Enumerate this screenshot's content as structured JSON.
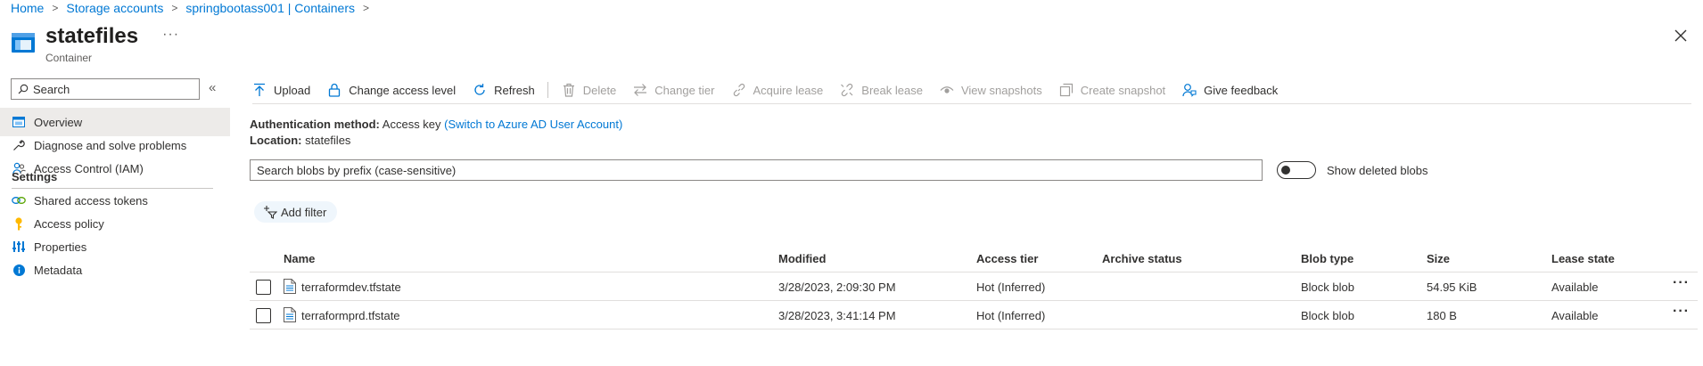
{
  "breadcrumb": [
    "Home",
    "Storage accounts",
    "springbootass001 | Containers"
  ],
  "header": {
    "title": "statefiles",
    "subtitle": "Container",
    "more": "···"
  },
  "sidebar": {
    "search_placeholder": "Search",
    "collapse": "«",
    "items": [
      {
        "label": "Overview",
        "icon": "overview-icon"
      },
      {
        "label": "Diagnose and solve problems",
        "icon": "wrench-icon"
      },
      {
        "label": "Access Control (IAM)",
        "icon": "people-icon"
      }
    ],
    "section": "Settings",
    "settings_items": [
      {
        "label": "Shared access tokens",
        "icon": "link-icon"
      },
      {
        "label": "Access policy",
        "icon": "key-icon"
      },
      {
        "label": "Properties",
        "icon": "properties-icon"
      },
      {
        "label": "Metadata",
        "icon": "info-icon"
      }
    ]
  },
  "toolbar": {
    "upload": "Upload",
    "change_access": "Change access level",
    "refresh": "Refresh",
    "delete": "Delete",
    "change_tier": "Change tier",
    "acquire_lease": "Acquire lease",
    "break_lease": "Break lease",
    "view_snapshots": "View snapshots",
    "create_snapshot": "Create snapshot",
    "feedback": "Give feedback"
  },
  "info": {
    "auth_label": "Authentication method:",
    "auth_value": "Access key",
    "auth_link": "(Switch to Azure AD User Account)",
    "location_label": "Location:",
    "location_value": "statefiles"
  },
  "blob_search_placeholder": "Search blobs by prefix (case-sensitive)",
  "show_deleted": "Show deleted blobs",
  "add_filter": "Add filter",
  "table": {
    "columns": [
      "Name",
      "Modified",
      "Access tier",
      "Archive status",
      "Blob type",
      "Size",
      "Lease state"
    ],
    "rows": [
      {
        "name": "terraformdev.tfstate",
        "modified": "3/28/2023, 2:09:30 PM",
        "tier": "Hot (Inferred)",
        "archive": "",
        "type": "Block blob",
        "size": "54.95 KiB",
        "lease": "Available"
      },
      {
        "name": "terraformprd.tfstate",
        "modified": "3/28/2023, 3:41:14 PM",
        "tier": "Hot (Inferred)",
        "archive": "",
        "type": "Block blob",
        "size": "180 B",
        "lease": "Available"
      }
    ]
  },
  "colors": {
    "accent": "#0078d4",
    "active_bg": "#edebe9",
    "text": "#323130",
    "disabled": "#a19f9d"
  }
}
